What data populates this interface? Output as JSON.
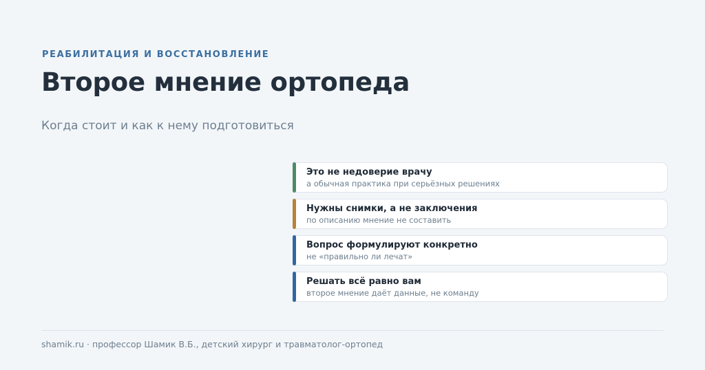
{
  "header": {
    "kicker": "РЕАБИЛИТАЦИЯ И ВОССТАНОВЛЕНИЕ",
    "title": "Второе мнение ортопеда",
    "subtitle": "Когда стоит и как к нему подготовиться"
  },
  "cards": [
    {
      "title": "Это не недоверие врачу",
      "subtitle": "а обычная практика при серьёзных решениях",
      "accent": "#4e8a69"
    },
    {
      "title": "Нужны снимки, а не заключения",
      "subtitle": "по описанию мнение не составить",
      "accent": "#b5843a"
    },
    {
      "title": "Вопрос формулируют конкретно",
      "subtitle": "не «правильно ли лечат»",
      "accent": "#3266a3"
    },
    {
      "title": "Решать всё равно вам",
      "subtitle": "второе мнение даёт данные, не команду",
      "accent": "#3266a3"
    }
  ],
  "footer": {
    "text": "shamik.ru · профессор Шамик В.Б., детский хирург и травматолог-ортопед"
  }
}
